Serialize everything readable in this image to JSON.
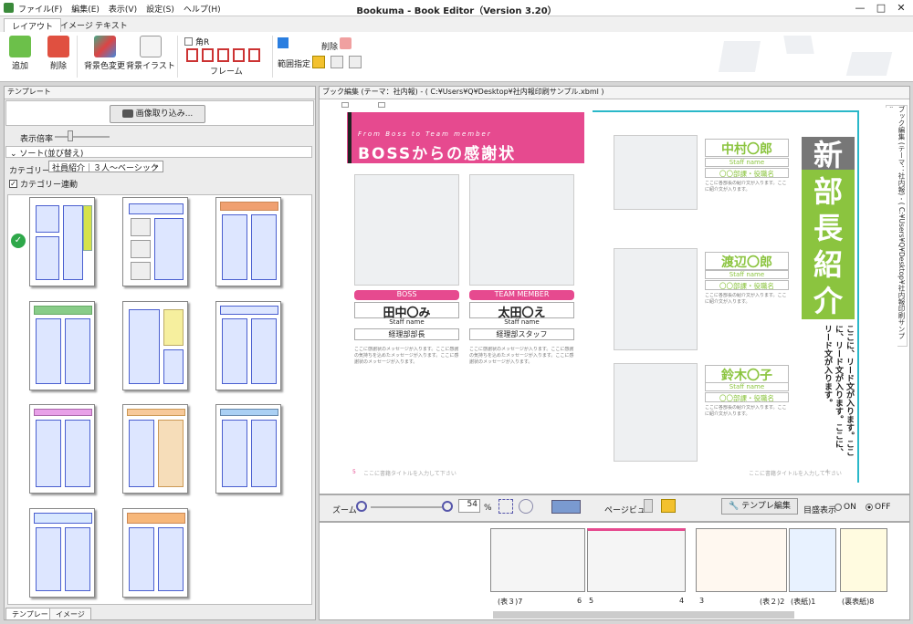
{
  "titlebar": {
    "title": "Bookuma - Book Editor（Version 3.20）",
    "menu": [
      "ファイル(F)",
      "編集(E)",
      "表示(V)",
      "設定(S)",
      "ヘルプ(H)"
    ],
    "min": "—",
    "max": "□",
    "close": "✕"
  },
  "ribbon": {
    "tabs": [
      "レイアウト",
      "イメージ",
      "テキスト"
    ],
    "add": "追加",
    "delete": "削除",
    "bg_color": "背景色変更",
    "bg_illust": "背景イラスト",
    "corner_r": "角R",
    "frame": "フレーム",
    "range": "範囲指定",
    "delete2": "削除"
  },
  "left": {
    "header": "テンプレート",
    "import_btn": "画像取り込み...",
    "zoom_label": "表示倍率",
    "sort_label": "ソート(並び替え)",
    "category_label": "カテゴリー",
    "category_value": "社員紹介｜３人〜ベーシック",
    "category_link": "カテゴリー連動",
    "bottom_tabs": [
      "テンプレート",
      "イメージ"
    ]
  },
  "editor": {
    "header": "ブック編集 (テーマ：社内報) - ( C:¥Users¥Q¥Desktop¥社内報印刷サンプル.xbml )",
    "side_caption": "ブック編集 (テーマ：社内報) - ( C:¥Users¥Q¥Desktop¥社内報印刷サンプル.xbml )",
    "left_page": {
      "eyebrow": "From Boss to Team member",
      "title": "BOSSからの感謝状",
      "boss_tag": "BOSS",
      "member_tag": "TEAM MEMBER",
      "boss_name": "田中〇み",
      "member_name": "太田〇え",
      "staff_label": "Staff name",
      "boss_dept": "経理部部長",
      "member_dept": "経理部スタッフ",
      "body": "ここに感謝状のメッセージが入ります。ここに感謝の気持ちを込めたメッセージが入ります。ここに感謝状のメッセージが入ります。",
      "footer": "ここに書籍タイトルを入力して下さい",
      "page_no": "5"
    },
    "right_page": {
      "vertical_title": [
        "新",
        "部",
        "長",
        "紹",
        "介"
      ],
      "lead": "ここに、リード文が入ります。ここに、リード文が入ります。ここに、リード文が入ります。",
      "people": [
        {
          "name": "中村〇郎",
          "staff": "Staff name",
          "dept": "〇〇部課・役職名"
        },
        {
          "name": "渡辺〇郎",
          "staff": "Staff name",
          "dept": "〇〇部課・役職名"
        },
        {
          "name": "鈴木〇子",
          "staff": "Staff name",
          "dept": "〇〇部課・役職名"
        }
      ],
      "body": "ここに各部長の紹介文が入ります。ここに紹介文が入ります。",
      "footer": "ここに書籍タイトルを入力して下さい",
      "page_no": "4"
    }
  },
  "toolbar": {
    "zoom_label": "ズーム",
    "zoom_value": "54",
    "percent": "%",
    "page_view": "ページビュー",
    "template_edit": "テンプレ編集",
    "spread_display": "目盛表示",
    "on": "ON",
    "off": "OFF"
  },
  "pagelist": {
    "labels": [
      "(表３)7",
      "6",
      "5",
      "4",
      "3",
      "(表２)2",
      "(表紙)1",
      "(裏表紙)8"
    ]
  }
}
